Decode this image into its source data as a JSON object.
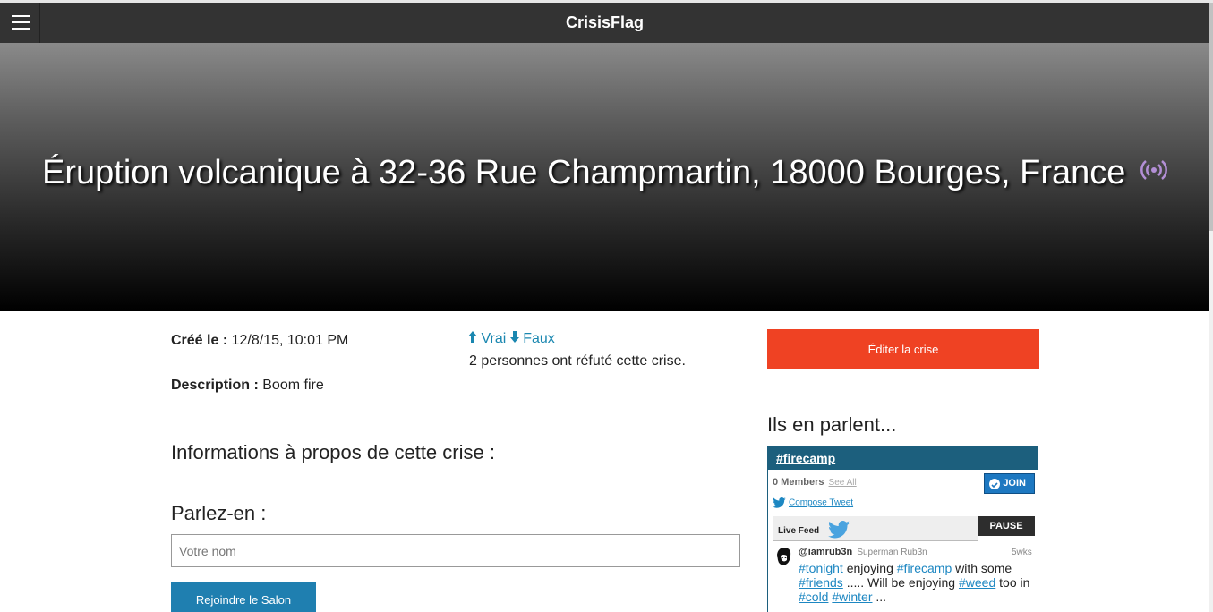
{
  "navbar": {
    "brand": "CrisisFlag"
  },
  "hero": {
    "title": "Éruption volcanique à 32-36 Rue Champmartin, 18000 Bourges, France",
    "icon": "broadcast-icon",
    "icon_color": "#b38fd6"
  },
  "details": {
    "created_label": "Créé le :",
    "created_value": "12/8/15, 10:01 PM",
    "description_label": "Description :",
    "description_value": "Boom fire"
  },
  "vote": {
    "true_label": "Vrai",
    "false_label": "Faux",
    "up_icon": "arrow-up-icon",
    "down_icon": "arrow-down-icon",
    "refute_text": "2 personnes ont réfuté cette crise."
  },
  "main": {
    "info_heading": "Informations à propos de cette crise :",
    "talk_heading": "Parlez-en :",
    "name_placeholder": "Votre nom",
    "join_room_label": "Rejoindre le Salon"
  },
  "sidebar": {
    "edit_label": "Éditer la crise",
    "talk_title": "Ils en parlent...",
    "widget": {
      "hashtag": "#firecamp",
      "members_text": "0 Members",
      "see_all": "See All",
      "join_label": "JOIN",
      "compose_label": "Compose Tweet",
      "live_feed_label": "Live Feed",
      "pause_label": "PAUSE",
      "tweet": {
        "handle": "@iamrub3n",
        "name": "Superman Rub3n",
        "time": "5wks",
        "tag_tonight": "#tonight",
        "text_1": " enjoying ",
        "tag_firecamp": "#firecamp",
        "text_2": " with some ",
        "tag_friends": "#friends",
        "text_3": " ..... Will be enjoying ",
        "tag_weed": "#weed",
        "text_4": " too in ",
        "tag_cold": "#cold",
        "text_5": " ",
        "tag_winter": "#winter",
        "text_6": " ..."
      }
    }
  },
  "colors": {
    "navbar": "#333333",
    "edit_button": "#ef4223",
    "join_room_button": "#1f7fb0",
    "widget_header": "#1c5f7d",
    "link": "#1a87b0"
  }
}
